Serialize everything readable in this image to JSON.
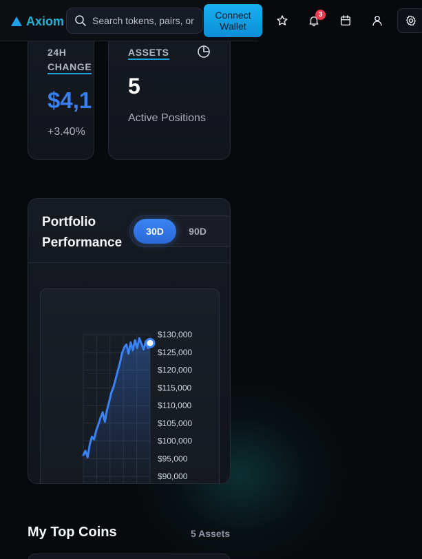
{
  "header": {
    "brand": "Axiom",
    "search_placeholder": "Search tokens, pairs, or",
    "connect_label": "Connect Wallet",
    "notification_count": "3",
    "icons": [
      "search-icon",
      "star-icon",
      "bell-icon",
      "calendar-icon",
      "user-icon",
      "gear-icon"
    ]
  },
  "stats": {
    "change": {
      "label_line1": "24H",
      "label_line2": "CHANGE",
      "value": "$4,1",
      "percent": "+3.40%"
    },
    "assets": {
      "label": "ASSETS",
      "value": "5",
      "subtitle": "Active Positions",
      "icon": "pie-chart-icon"
    }
  },
  "performance": {
    "title": "Portfolio Performance",
    "tabs": [
      {
        "label": "30D",
        "active": true
      },
      {
        "label": "90D",
        "active": false
      }
    ]
  },
  "chart_data": {
    "type": "line",
    "title": "",
    "xlabel": "",
    "ylabel": "",
    "ylim": [
      90000,
      130000
    ],
    "y_ticks": [
      {
        "value": 130000,
        "label": "$130,000"
      },
      {
        "value": 125000,
        "label": "$125,000"
      },
      {
        "value": 120000,
        "label": "$120,000"
      },
      {
        "value": 115000,
        "label": "$115,000"
      },
      {
        "value": 110000,
        "label": "$110,000"
      },
      {
        "value": 105000,
        "label": "$105,000"
      },
      {
        "value": 100000,
        "label": "$100,000"
      },
      {
        "value": 95000,
        "label": "$95,000"
      },
      {
        "value": 90000,
        "label": "$90,000"
      }
    ],
    "grid": true,
    "series": [
      {
        "color": "#3b82f6",
        "values": [
          96000,
          97200,
          95400,
          99000,
          101200,
          100400,
          103000,
          104600,
          106500,
          108100,
          105400,
          108700,
          111000,
          113600,
          115200,
          117400,
          119800,
          122000,
          124800,
          126400,
          127200,
          124600,
          127800,
          125600,
          128400,
          126200,
          129000,
          127400,
          125800,
          128100,
          126200,
          127600
        ]
      }
    ]
  },
  "coins": {
    "title": "My Top Coins",
    "count": "5 Assets"
  },
  "colors": {
    "accent": "#1da1e8",
    "chart_line": "#3b82f6",
    "badge": "#ef3b4d",
    "background": "#08090c"
  }
}
